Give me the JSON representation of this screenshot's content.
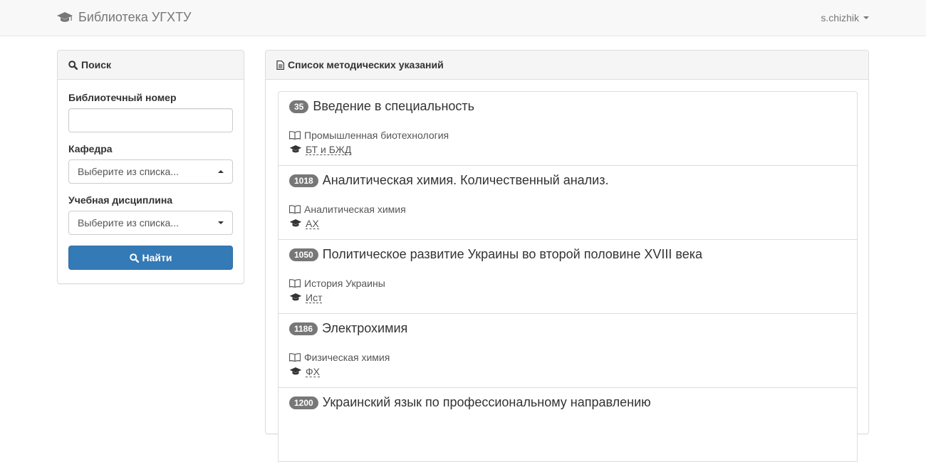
{
  "navbar": {
    "brand": "Библиотека УГХТУ",
    "user": "s.chizhik"
  },
  "search": {
    "heading": "Поиск",
    "library_number_label": "Библиотечный номер",
    "library_number_value": "",
    "department_label": "Кафедра",
    "department_placeholder": "Выберите из списка...",
    "discipline_label": "Учебная дисциплина",
    "discipline_placeholder": "Выберите из списка...",
    "submit_label": "Найти"
  },
  "list": {
    "heading": "Список методических указаний",
    "items": [
      {
        "id": "35",
        "title": "Введение в специальность",
        "discipline": "Промышленная биотехнология",
        "department": "БТ и БЖД"
      },
      {
        "id": "1018",
        "title": "Аналитическая химия. Количественный анализ.",
        "discipline": "Аналитическая химия",
        "department": "АХ"
      },
      {
        "id": "1050",
        "title": "Политическое развитие Украины во второй половине XVIII века",
        "discipline": "История Украины",
        "department": "Ист"
      },
      {
        "id": "1186",
        "title": "Электрохимия",
        "discipline": "Физическая химия",
        "department": "ФХ"
      },
      {
        "id": "1200",
        "title": "Украинский язык по профессиональному направлению",
        "discipline": "",
        "department": ""
      }
    ]
  },
  "colors": {
    "primary": "#337ab7",
    "badge": "#777777",
    "navbar_bg": "#f8f8f8",
    "panel_heading_bg": "#f5f5f5"
  },
  "icons": {
    "brand": "graduation-cap-icon",
    "search": "search-icon",
    "list": "file-text-icon",
    "discipline": "book-icon",
    "department": "graduation-cap-icon"
  }
}
